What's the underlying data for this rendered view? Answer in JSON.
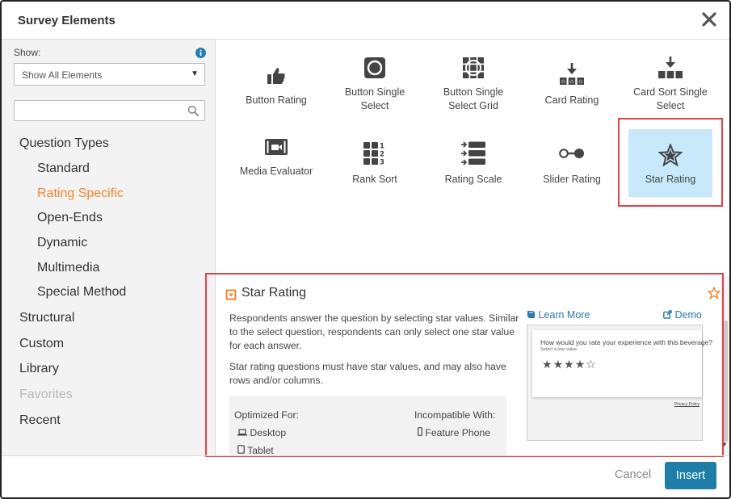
{
  "dialog": {
    "title": "Survey Elements"
  },
  "sidebar": {
    "show_label": "Show:",
    "show_value": "Show All Elements",
    "search_placeholder": "",
    "nav": [
      {
        "label": "Question Types"
      },
      {
        "label": "Standard"
      },
      {
        "label": "Rating Specific"
      },
      {
        "label": "Open-Ends"
      },
      {
        "label": "Dynamic"
      },
      {
        "label": "Multimedia"
      },
      {
        "label": "Special Method"
      },
      {
        "label": "Structural"
      },
      {
        "label": "Custom"
      },
      {
        "label": "Library"
      },
      {
        "label": "Favorites"
      },
      {
        "label": "Recent"
      }
    ]
  },
  "elements": [
    {
      "label": "Button Rating",
      "icon": "thumbs-up-icon"
    },
    {
      "label": "Button Single Select",
      "icon": "circle-button-icon"
    },
    {
      "label": "Button Single Select Grid",
      "icon": "grid-circle-icon"
    },
    {
      "label": "Card Rating",
      "icon": "card-rating-icon"
    },
    {
      "label": "Card Sort Single Select",
      "icon": "card-sort-icon"
    },
    {
      "label": "Media Evaluator",
      "icon": "video-camera-icon"
    },
    {
      "label": "Rank Sort",
      "icon": "rank-sort-icon"
    },
    {
      "label": "Rating Scale",
      "icon": "rating-scale-icon"
    },
    {
      "label": "Slider Rating",
      "icon": "slider-icon"
    },
    {
      "label": "Star Rating",
      "icon": "star-icon"
    }
  ],
  "detail": {
    "title": "Star Rating",
    "para1": "Respondents answer the question by selecting star values. Similar to the select question, respondents can only select one star value for each answer.",
    "para2": "Star rating questions must have star values, and may also have rows and/or columns.",
    "learn_more": "Learn More",
    "demo": "Demo",
    "optimized_label": "Optimized For:",
    "optimized": [
      "Desktop",
      "Tablet"
    ],
    "incompatible_label": "Incompatible With:",
    "incompatible": [
      "Feature Phone"
    ],
    "preview": {
      "question": "How would you rate your experience with this beverage?",
      "instruction": "Select a star value.",
      "rating": 4,
      "max_rating": 5,
      "policy": "Privacy Policy"
    }
  },
  "footer": {
    "cancel": "Cancel",
    "insert": "Insert"
  },
  "colors": {
    "accent_orange": "#f0852d",
    "primary_blue": "#1e7ea8",
    "selected_tile": "#c8e9fb",
    "highlight_red": "#e0434a"
  }
}
